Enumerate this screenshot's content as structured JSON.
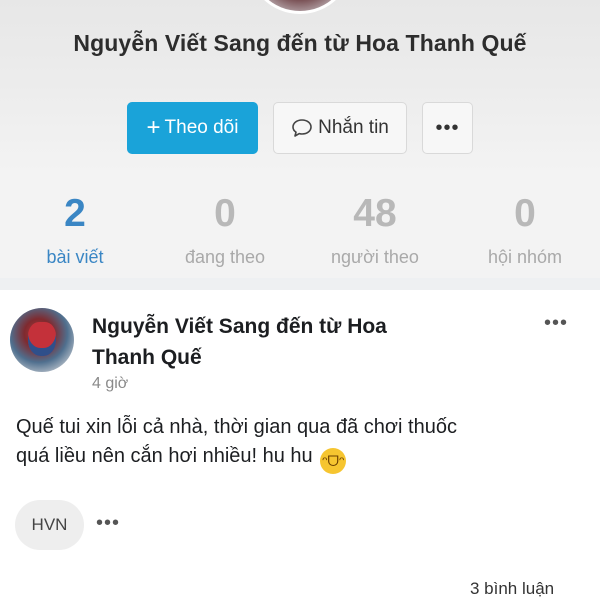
{
  "profile": {
    "name": "Nguyễn Viết Sang đến từ Hoa Thanh Quế"
  },
  "actions": {
    "follow_label": "Theo dõi",
    "follow_icon": "plus-icon",
    "message_label": "Nhắn tin",
    "message_icon": "chat-bubble-icon",
    "more_label": "•••"
  },
  "stats": [
    {
      "value": "2",
      "label": "bài viết",
      "active": true
    },
    {
      "value": "0",
      "label": "đang theo",
      "active": false
    },
    {
      "value": "48",
      "label": "người theo",
      "active": false
    },
    {
      "value": "0",
      "label": "hội nhóm",
      "active": false
    }
  ],
  "post": {
    "author_line1": "Nguyễn Viết Sang đến từ Hoa",
    "author_line2": "Thanh Quế",
    "time": "4 giờ",
    "menu_label": "•••",
    "body_line1": "Quế tui xin lỗi cả nhà, thời gian qua đã chơi thuốc",
    "body_line2": "quá liều nên cắn hơi nhiều! hu hu",
    "emoji_name": "rolling-on-floor-laughing-emoji",
    "tag": "HVN",
    "more_label": "•••",
    "comments": "3 bình luận"
  },
  "colors": {
    "accent": "#1aa3d9",
    "active_stat": "#3a86c4",
    "inactive_stat": "#b8b8b8"
  }
}
